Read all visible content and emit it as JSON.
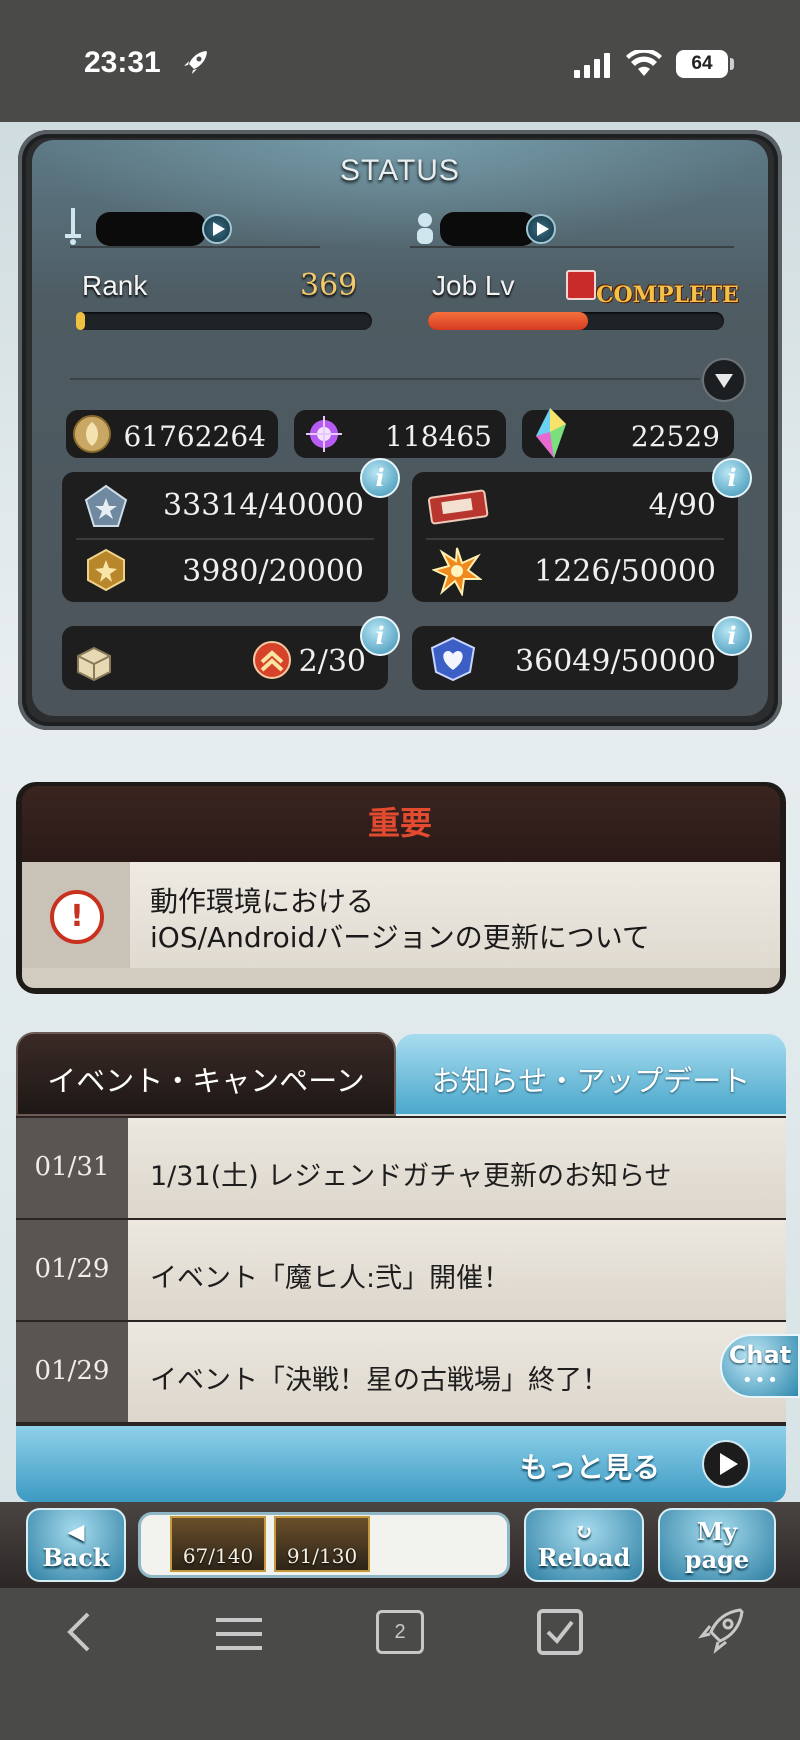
{
  "status_bar": {
    "time": "23:31",
    "battery": "64"
  },
  "status": {
    "title": "STATUS",
    "rank_label": "Rank",
    "rank_value": "369",
    "rank_progress": 0.03,
    "job_label": "Job Lv",
    "job_status": "COMPLETE",
    "job_progress": 0.54,
    "currencies": [
      {
        "icon": "rupie-coin-icon",
        "value": "61762264"
      },
      {
        "icon": "crystal-orb-icon",
        "value": "118465"
      },
      {
        "icon": "rainbow-crystal-icon",
        "value": "22529"
      }
    ],
    "stats": {
      "silver_blue": "33314/40000",
      "gold_shard": "3980/20000",
      "ticket": "4/90",
      "explosion": "1226/50000",
      "crate_count": "2/30",
      "heart_gem": "36049/50000"
    }
  },
  "important": {
    "title": "重要",
    "line1": "動作環境における",
    "line2": "iOS/Androidバージョンの更新について"
  },
  "tabs": {
    "active": "イベント・キャンペーン",
    "inactive": "お知らせ・アップデート"
  },
  "news": [
    {
      "date": "01/31",
      "title": "1/31(土) レジェンドガチャ更新のお知らせ"
    },
    {
      "date": "01/29",
      "title": "イベント「魔ヒ人:弐」開催！"
    },
    {
      "date": "01/29",
      "title": "イベント「決戦！星の古戦場」終了！"
    }
  ],
  "more_label": "もっと見る",
  "chat_label": "Chat",
  "game_nav": {
    "back": "Back",
    "reload": "Reload",
    "mypage_1": "My",
    "mypage_2": "page",
    "card1": "67/140",
    "card2": "91/130"
  },
  "browser": {
    "tab_count": "2"
  },
  "colors": {
    "accent_blue": "#4ba8cc",
    "important_red": "#e24b2f",
    "job_bar": "#e0522e",
    "gold": "#f2c86b"
  }
}
